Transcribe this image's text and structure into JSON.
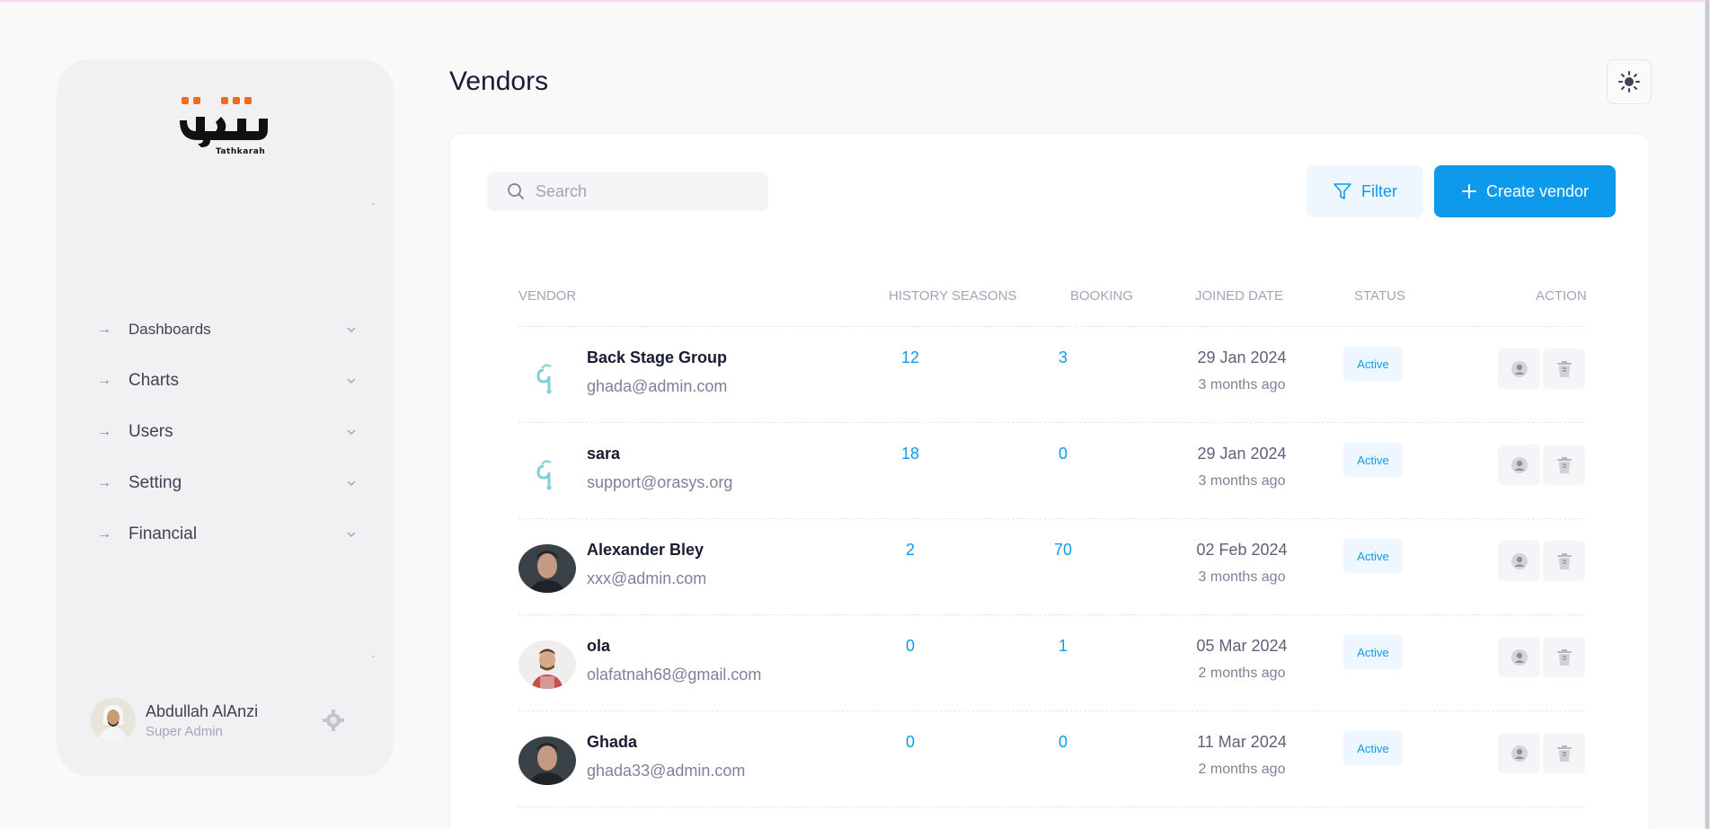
{
  "brand": {
    "logo_text": "Tathkarah"
  },
  "sidebar": {
    "items": [
      {
        "label": "Dashboards",
        "icon": "arrow-right-icon"
      },
      {
        "label": "Charts",
        "icon": "arrow-right-icon"
      },
      {
        "label": "Users",
        "icon": "arrow-right-icon"
      },
      {
        "label": "Setting",
        "icon": "arrow-right-icon"
      },
      {
        "label": "Financial",
        "icon": "arrow-right-icon"
      }
    ],
    "user": {
      "name": "Abdullah AlAnzi",
      "role": "Super Admin"
    }
  },
  "header": {
    "title": "Vendors"
  },
  "toolbar": {
    "search_placeholder": "Search",
    "filter_label": "Filter",
    "create_label": "Create vendor"
  },
  "table": {
    "columns": [
      "Vendor",
      "History Seasons",
      "Booking",
      "Joined Date",
      "Status",
      "Action"
    ],
    "rows": [
      {
        "name": "Back Stage Group",
        "email": "ghada@admin.com",
        "seasons": "12",
        "booking": "3",
        "date": "29 Jan 2024",
        "ago": "3 months ago",
        "status": "Active",
        "avatar": "logo"
      },
      {
        "name": "sara",
        "email": "support@orasys.org",
        "seasons": "18",
        "booking": "0",
        "date": "29 Jan 2024",
        "ago": "3 months ago",
        "status": "Active",
        "avatar": "logo"
      },
      {
        "name": "Alexander Bley",
        "email": "xxx@admin.com",
        "seasons": "2",
        "booking": "70",
        "date": "02 Feb 2024",
        "ago": "3 months ago",
        "status": "Active",
        "avatar": "photo-dark"
      },
      {
        "name": "ola",
        "email": "olafatnah68@gmail.com",
        "seasons": "0",
        "booking": "1",
        "date": "05 Mar 2024",
        "ago": "2 months ago",
        "status": "Active",
        "avatar": "photo-light"
      },
      {
        "name": "Ghada",
        "email": "ghada33@admin.com",
        "seasons": "0",
        "booking": "0",
        "date": "11 Mar 2024",
        "ago": "2 months ago",
        "status": "Active",
        "avatar": "photo-dark"
      }
    ]
  },
  "colors": {
    "primary": "#0d9aed",
    "brand_orange": "#f26b1d",
    "sidebar_bg": "#f1f1f4"
  }
}
